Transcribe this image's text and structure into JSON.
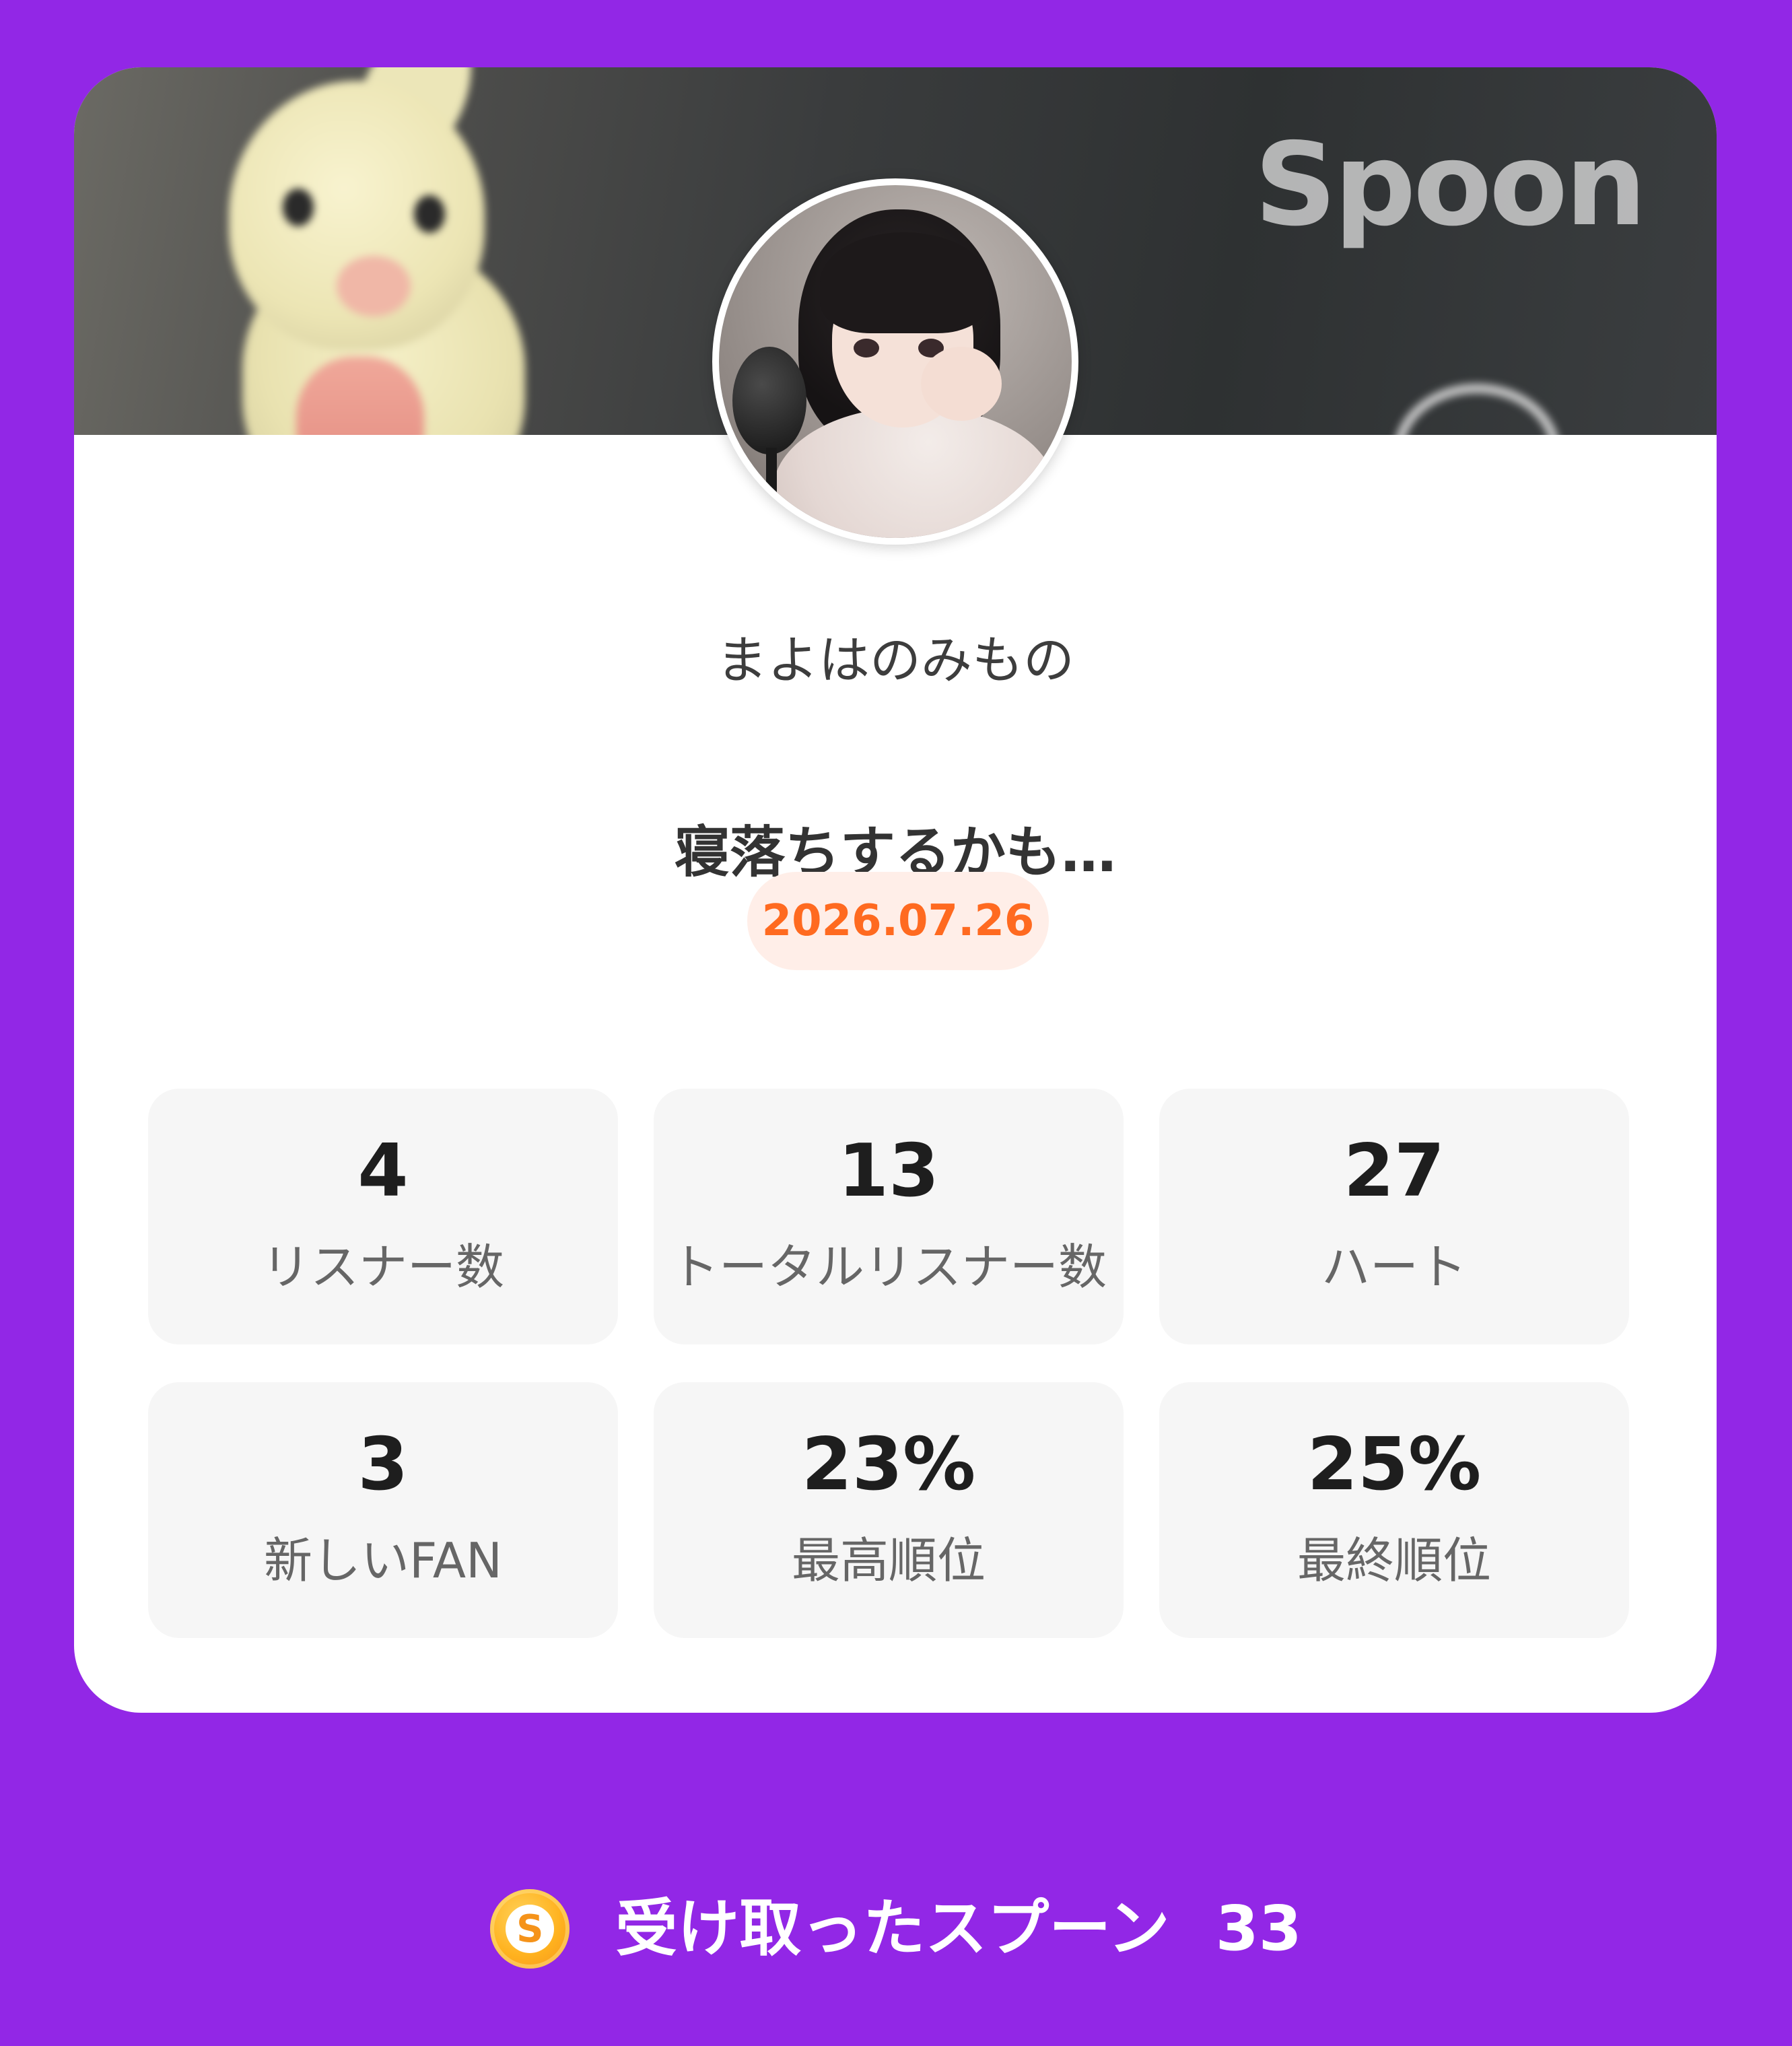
{
  "brand": {
    "logo_text": "Spoon"
  },
  "profile": {
    "username": "まよはのみもの"
  },
  "stream": {
    "title": "寝落ちするかも…",
    "date": "2026.07.26"
  },
  "stats": [
    {
      "value": "4",
      "label": "リスナー数"
    },
    {
      "value": "13",
      "label": "トータルリスナー数"
    },
    {
      "value": "27",
      "label": "ハート"
    },
    {
      "value": "3",
      "label": "新しいFAN"
    },
    {
      "value": "23%",
      "label": "最高順位"
    },
    {
      "value": "25%",
      "label": "最終順位"
    }
  ],
  "received": {
    "icon": "spoon-coin-icon",
    "coin_letter": "S",
    "label": "受け取ったスプーン",
    "count": "33"
  },
  "colors": {
    "background": "#9227E6",
    "card": "#FFFFFF",
    "tile": "#F6F6F6",
    "date_badge_bg": "#FFEEE8",
    "date_text": "#FF6A20",
    "coin": "#FFB21F"
  }
}
